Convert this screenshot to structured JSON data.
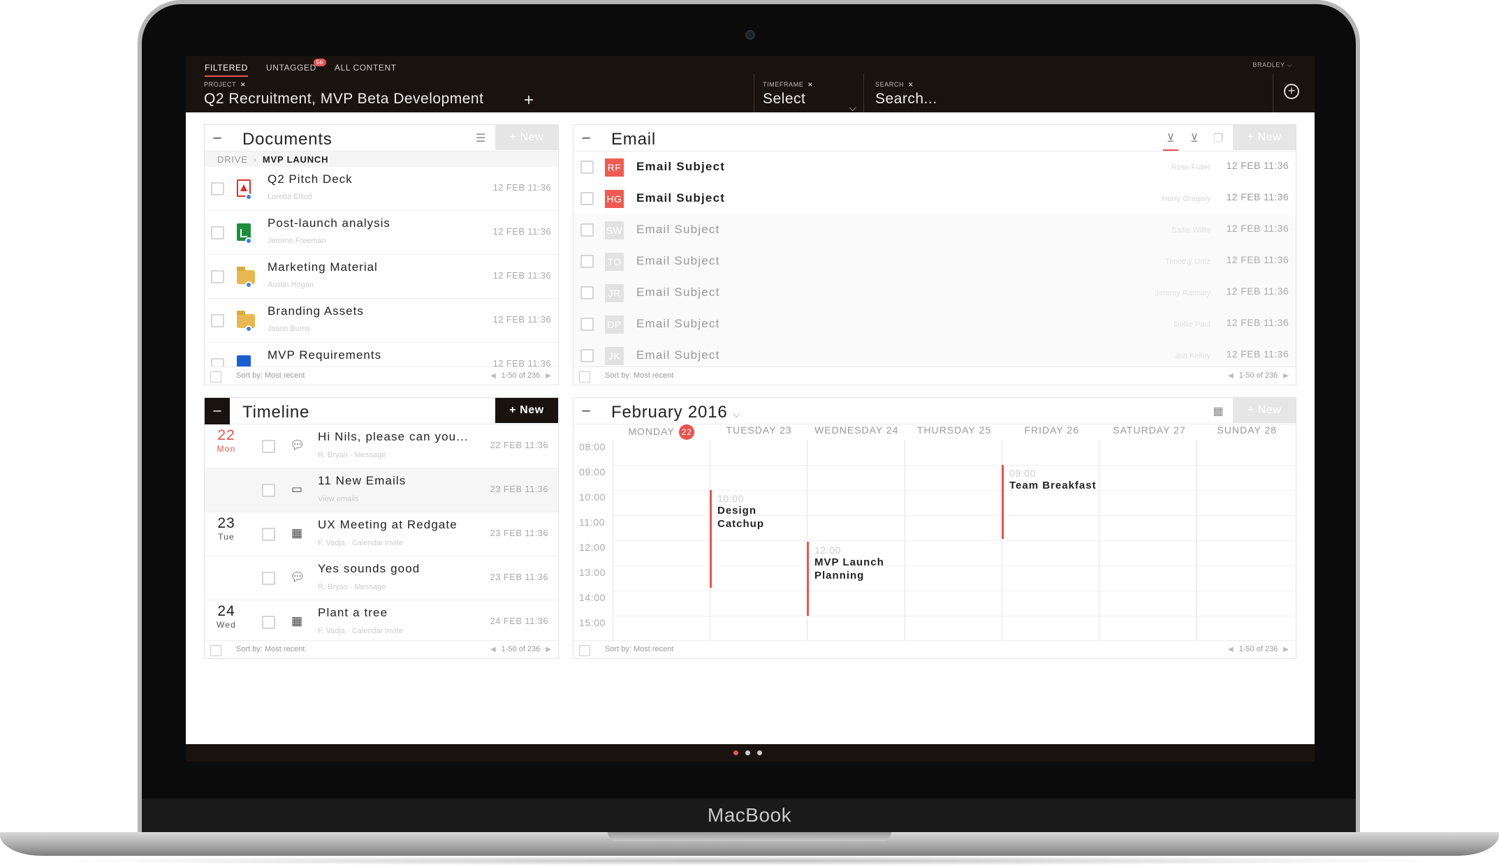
{
  "device": {
    "label": "MacBook"
  },
  "topbar": {
    "tabs": [
      {
        "label": "FILTERED",
        "active": true
      },
      {
        "label": "UNTAGGED",
        "badge": "56"
      },
      {
        "label": "ALL CONTENT"
      }
    ],
    "user": "BRADLEY",
    "project": {
      "label": "PROJECT",
      "value": "Q2 Recruitment, MVP Beta Development"
    },
    "timeframe": {
      "label": "TIMEFRAME",
      "value": "Select"
    },
    "search": {
      "label": "SEARCH",
      "placeholder": "Search..."
    }
  },
  "documents": {
    "title": "Documents",
    "new_label": "+ New",
    "breadcrumb": {
      "root": "DRIVE",
      "current": "MVP LAUNCH"
    },
    "items": [
      {
        "title": "Q2 Pitch Deck",
        "owner": "Loretta Elliott",
        "time": "12 FEB 11:36",
        "icon": "pdf"
      },
      {
        "title": "Post-launch analysis",
        "owner": "Jerome Freeman",
        "time": "12 FEB 11:36",
        "icon": "sheet"
      },
      {
        "title": "Marketing Material",
        "owner": "Austin Hogan",
        "time": "12 FEB 11:36",
        "icon": "folder"
      },
      {
        "title": "Branding Assets",
        "owner": "Jason Burns",
        "time": "12 FEB 11:36",
        "icon": "folder"
      },
      {
        "title": "MVP Requirements",
        "owner": "",
        "time": "12 FEB 11:36",
        "icon": "doc"
      }
    ],
    "footer": {
      "sort": "Sort by: Most recent",
      "range": "1-50 of 236"
    }
  },
  "email": {
    "title": "Email",
    "new_label": "+ New",
    "items": [
      {
        "initials": "RF",
        "subject": "Email Subject",
        "from": "Rose Fuller",
        "time": "12 FEB 11:36",
        "unread": true
      },
      {
        "initials": "HG",
        "subject": "Email Subject",
        "from": "Harry Gregory",
        "time": "12 FEB 11:36",
        "unread": true
      },
      {
        "initials": "SW",
        "subject": "Email Subject",
        "from": "Sallie Willis",
        "time": "12 FEB 11:36",
        "unread": false
      },
      {
        "initials": "TO",
        "subject": "Email Subject",
        "from": "Timothy Ortiz",
        "time": "12 FEB 11:36",
        "unread": false
      },
      {
        "initials": "JR",
        "subject": "Email Subject",
        "from": "Jeremy Ramsey",
        "time": "12 FEB 11:36",
        "unread": false
      },
      {
        "initials": "DP",
        "subject": "Email Subject",
        "from": "Dollie Paul",
        "time": "12 FEB 11:36",
        "unread": false
      },
      {
        "initials": "JK",
        "subject": "Email Subject",
        "from": "Jon Kelley",
        "time": "12 FEB 11:36",
        "unread": false
      }
    ],
    "footer": {
      "sort": "Sort by: Most recent",
      "range": "1-50 of 236"
    }
  },
  "timeline": {
    "title": "Timeline",
    "new_label": "+ New",
    "days": [
      {
        "num": "22",
        "name": "Mon",
        "today": true
      },
      {
        "num": "23",
        "name": "Tue",
        "today": false
      },
      {
        "num": "24",
        "name": "Wed",
        "today": false
      }
    ],
    "items": [
      {
        "title": "Hi Nils, please can you...",
        "sub": "R. Bryan · Message",
        "time": "22 FEB 11:36",
        "icon": "chat-bubble-icon"
      },
      {
        "title": "11 New Emails",
        "sub": "View emails",
        "time": "23 FEB 11:36",
        "icon": "inbox-icon"
      },
      {
        "title": "UX Meeting at Redgate",
        "sub": "F. Vadja · Calendar invite",
        "time": "23 FEB 11:36",
        "icon": "calendar-icon"
      },
      {
        "title": "Yes sounds good",
        "sub": "R. Bryan · Message",
        "time": "23 FEB 11:36",
        "icon": "chat-bubble-icon"
      },
      {
        "title": "Plant a tree",
        "sub": "F. Vadja · Calendar invite",
        "time": "24 FEB 11:36",
        "icon": "calendar-icon"
      }
    ],
    "footer": {
      "sort": "Sort by: Most recent",
      "range": "1-50 of 236"
    }
  },
  "calendar": {
    "title": "February 2016",
    "new_label": "+ New",
    "days": [
      "MONDAY",
      "TUESDAY 23",
      "WEDNESDAY 24",
      "THURSDAY 25",
      "FRIDAY 26",
      "SATURDAY 27",
      "SUNDAY 28"
    ],
    "today_badge": "22",
    "hours": [
      "08:00",
      "09:00",
      "10:00",
      "11:00",
      "12:00",
      "13:00",
      "14:00",
      "15:00"
    ],
    "events": [
      {
        "time": "10:00",
        "title": "Design Catchup"
      },
      {
        "time": "12:00",
        "title": "MVP Launch Planning"
      },
      {
        "time": "09:00",
        "title": "Team Breakfast"
      }
    ],
    "footer": {
      "sort": "Sort by: Most recent",
      "range": "1-50 of 236"
    }
  },
  "pagination": {
    "pages": 3,
    "active_page": 1
  },
  "colors": {
    "accent": "#e9534f",
    "topbar": "#19130f",
    "avatar_rf": "#f05a50",
    "avatar_hg": "#f05a50",
    "avatar_read": "#e2e2e2"
  }
}
